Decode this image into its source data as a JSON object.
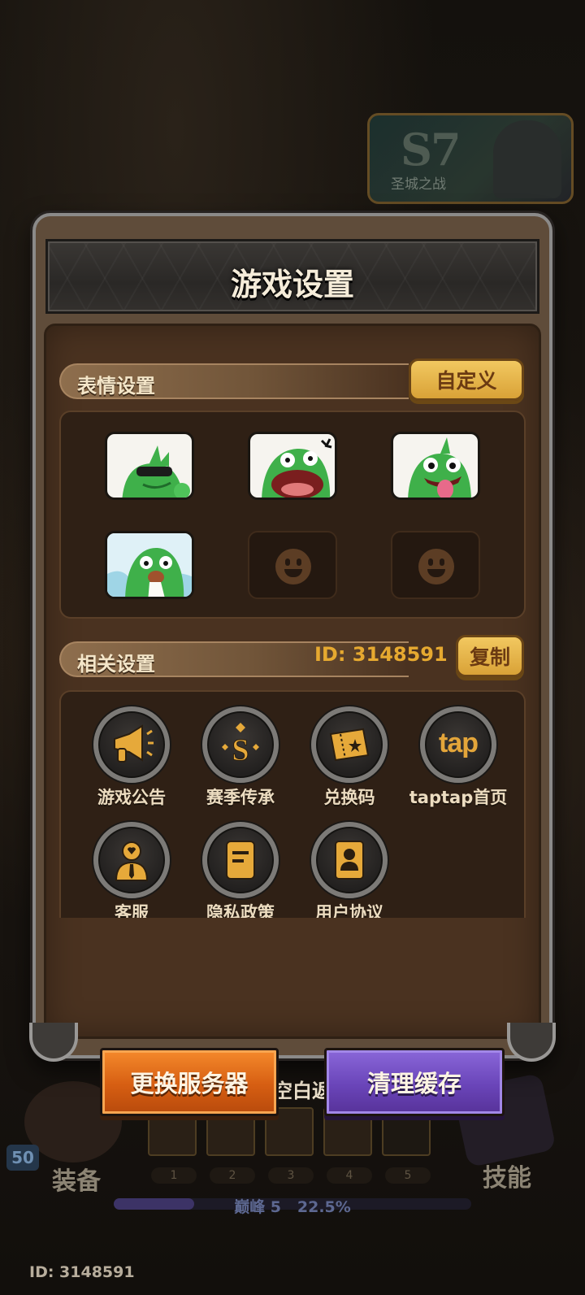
{
  "background": {
    "season_badge": {
      "season": "S7",
      "subtitle": "圣城之战"
    },
    "hud": {
      "level": "50",
      "left_label": "装备",
      "right_label": "技能",
      "slot_numbers": [
        "1",
        "2",
        "3",
        "4",
        "5"
      ],
      "peak_rank": "巅峰 5",
      "peak_percent": "22.5%",
      "peak_fraction": 0.225,
      "bottom_id": "ID: 3148591"
    },
    "dismiss_hint": "点击空白返回"
  },
  "panel": {
    "title": "游戏设置",
    "emote_section": {
      "header": "表情设置",
      "custom_button": "自定义",
      "slots": [
        {
          "state": "filled",
          "icon": "frog-sunglasses-emote-icon"
        },
        {
          "state": "filled",
          "icon": "frog-shouting-emote-icon"
        },
        {
          "state": "filled",
          "icon": "frog-tongue-emote-icon"
        },
        {
          "state": "filled",
          "icon": "frog-crying-emote-icon"
        },
        {
          "state": "empty",
          "icon": "smiley-placeholder-icon"
        },
        {
          "state": "empty",
          "icon": "smiley-placeholder-icon"
        }
      ]
    },
    "related_section": {
      "header": "相关设置",
      "user_id": "ID: 3148591",
      "copy_button": "复制",
      "items": [
        {
          "label": "游戏公告",
          "icon": "megaphone-icon"
        },
        {
          "label": "赛季传承",
          "icon": "season-s-icon"
        },
        {
          "label": "兑换码",
          "icon": "ticket-icon"
        },
        {
          "label": "taptap首页",
          "icon": "taptap-logo-icon",
          "logo_text": "tap"
        },
        {
          "label": "客服",
          "icon": "customer-service-icon"
        },
        {
          "label": "隐私政策",
          "icon": "document-icon"
        },
        {
          "label": "用户协议",
          "icon": "user-card-icon"
        }
      ]
    },
    "buttons": {
      "change_server": "更换服务器",
      "clear_cache": "清理缓存"
    }
  },
  "colors": {
    "gold": "#e6a930",
    "orange_button": "#e06a18",
    "purple_button": "#6d48bd",
    "panel_brown": "#4a3220"
  }
}
